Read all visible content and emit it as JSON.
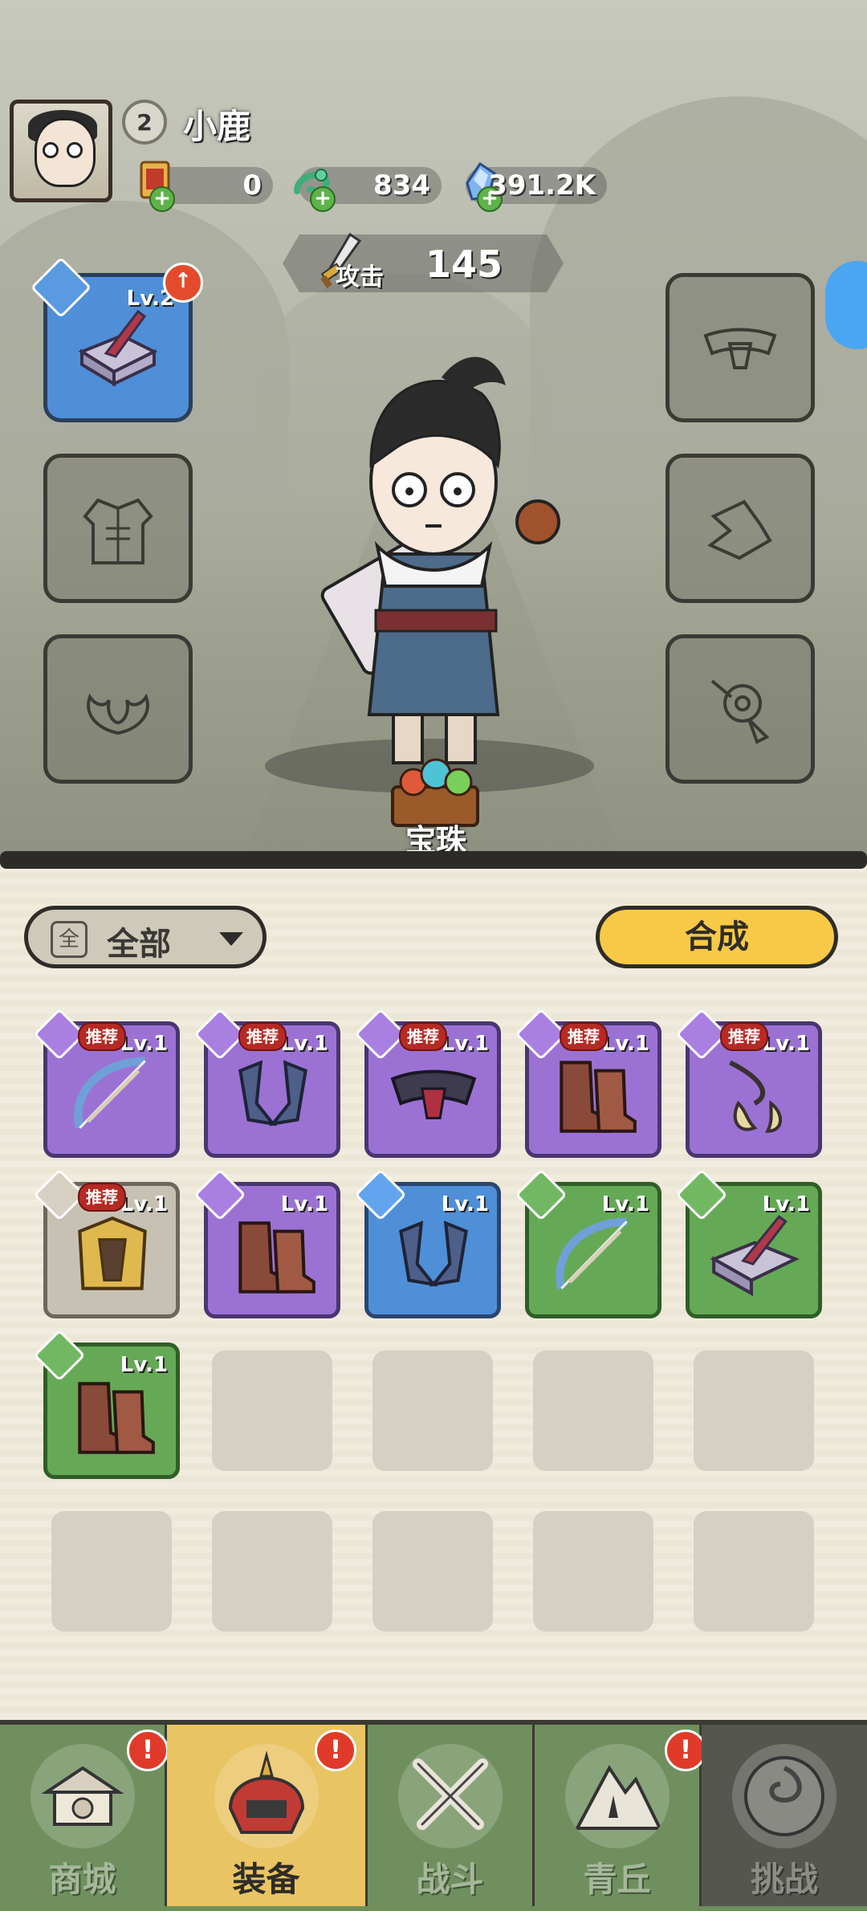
{
  "player": {
    "level": "2",
    "name": "小鹿"
  },
  "resources": [
    {
      "icon": "scroll-ticket-icon",
      "value": "0"
    },
    {
      "icon": "jade-dragon-icon",
      "value": "834"
    },
    {
      "icon": "blue-crystal-icon",
      "value": "391.2K"
    }
  ],
  "attack": {
    "label": "攻击",
    "value": "145"
  },
  "equip_slots": {
    "weapon": {
      "level": "Lv.2",
      "icon": "hammer-icon",
      "upgradable": true
    },
    "armor": {
      "icon": "robe-outline-icon"
    },
    "ornament": {
      "icon": "horn-ornament-outline-icon"
    },
    "belt": {
      "icon": "belt-outline-icon"
    },
    "boots": {
      "icon": "boot-outline-icon"
    },
    "accessory": {
      "icon": "pendant-outline-icon"
    }
  },
  "gem_label": "宝珠",
  "filter": {
    "icon_text": "全",
    "label": "全部"
  },
  "merge_label": "合成",
  "inventory": [
    {
      "rarity": "purple",
      "icon": "bow-icon",
      "level": "Lv.1",
      "badge": "推荐"
    },
    {
      "rarity": "purple",
      "icon": "horn-ornament-icon",
      "level": "Lv.1",
      "badge": "推荐"
    },
    {
      "rarity": "purple",
      "icon": "belt-icon",
      "level": "Lv.1",
      "badge": "推荐"
    },
    {
      "rarity": "purple",
      "icon": "boots-icon",
      "level": "Lv.1",
      "badge": "推荐"
    },
    {
      "rarity": "purple",
      "icon": "pendant-icon",
      "level": "Lv.1",
      "badge": "推荐"
    },
    {
      "rarity": "gray",
      "icon": "golden-armor-icon",
      "level": "Lv.1",
      "badge": "推荐"
    },
    {
      "rarity": "purple",
      "icon": "boots-icon",
      "level": "Lv.1",
      "badge": ""
    },
    {
      "rarity": "blue",
      "icon": "horn-ornament-icon",
      "level": "Lv.1",
      "badge": ""
    },
    {
      "rarity": "green",
      "icon": "bow-icon",
      "level": "Lv.1",
      "badge": ""
    },
    {
      "rarity": "green",
      "icon": "hammer-icon",
      "level": "Lv.1",
      "badge": ""
    },
    {
      "rarity": "green",
      "icon": "boots-icon",
      "level": "Lv.1",
      "badge": ""
    }
  ],
  "nav": [
    {
      "label": "商城",
      "icon": "shop-icon",
      "alert": "!"
    },
    {
      "label": "装备",
      "icon": "helmet-icon",
      "alert": "!"
    },
    {
      "label": "战斗",
      "icon": "crossed-swords-icon",
      "alert": ""
    },
    {
      "label": "青丘",
      "icon": "mountain-icon",
      "alert": "!"
    },
    {
      "label": "挑战",
      "icon": "vortex-icon",
      "alert": ""
    }
  ],
  "colors": {
    "purple": "#9b72d4",
    "blue": "#4f8fd8",
    "green": "#65a956",
    "gray": "#c7c1b3",
    "merge": "#f7c946",
    "active_tab": "#e9c463"
  }
}
